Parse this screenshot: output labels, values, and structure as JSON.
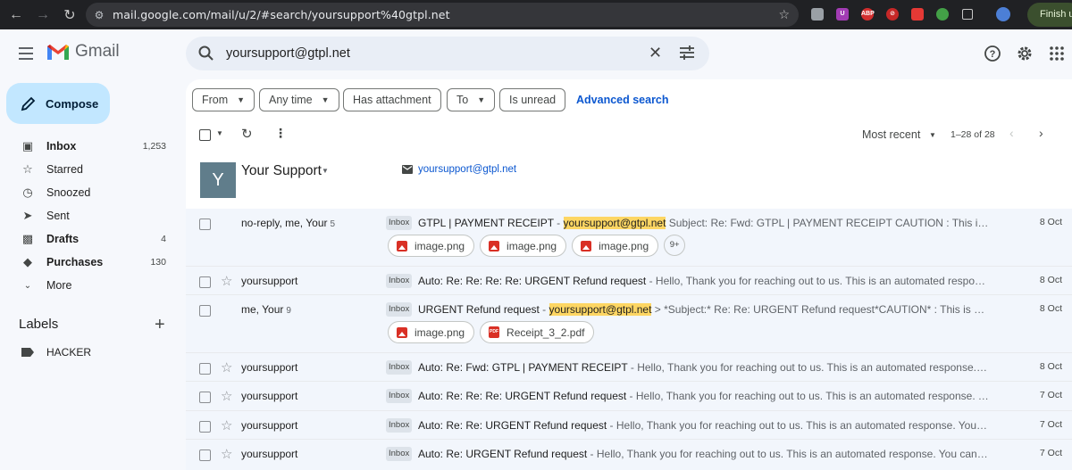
{
  "browser": {
    "url": "mail.google.com/mail/u/2/#search/yoursupport%40gtpl.net",
    "finish_label": "Finish up"
  },
  "app": {
    "name": "Gmail"
  },
  "search": {
    "query": "yoursupport@gtpl.net"
  },
  "compose_label": "Compose",
  "sidebar": {
    "items": [
      {
        "label": "Inbox",
        "count": "1,253",
        "icon": "inbox-icon"
      },
      {
        "label": "Starred",
        "count": "",
        "icon": "star-icon"
      },
      {
        "label": "Snoozed",
        "count": "",
        "icon": "clock-icon"
      },
      {
        "label": "Sent",
        "count": "",
        "icon": "send-icon"
      },
      {
        "label": "Drafts",
        "count": "4",
        "icon": "draft-icon"
      },
      {
        "label": "Purchases",
        "count": "130",
        "icon": "tag-icon"
      },
      {
        "label": "More",
        "count": "",
        "icon": "chevron-down-icon"
      }
    ],
    "labels_heading": "Labels",
    "labels": [
      {
        "label": "HACKER"
      }
    ]
  },
  "filters": {
    "from": "From",
    "time": "Any time",
    "attachment": "Has attachment",
    "to": "To",
    "unread": "Is unread",
    "advanced": "Advanced search"
  },
  "toolbar": {
    "sort": "Most recent",
    "pager": "1–28 of 28"
  },
  "contact": {
    "initial": "Y",
    "name": "Your Support",
    "email": "yoursupport@gtpl.net"
  },
  "emails": [
    {
      "sender": "no-reply, me, Your",
      "thread_count": "5",
      "badge": "Inbox",
      "subject": "GTPL | PAYMENT RECEIPT",
      "sep": " - ",
      "highlight": "yoursupport@gtpl.net",
      "snippet": " Subject: Re: Fwd: GTPL | PAYMENT RECEIPT CAUTION : This is outside ...",
      "date": "8 Oct",
      "attachments": [
        "image.png",
        "image.png",
        "image.png"
      ],
      "more_attachments": "9+"
    },
    {
      "sender": "yoursupport",
      "badge": "Inbox",
      "subject": "Auto: Re: Re: Re: Re: URGENT Refund request",
      "sep": " - ",
      "snippet": "Hello, Thank you for reaching out to us. This is an automated response. Yo...",
      "date": "8 Oct"
    },
    {
      "sender": "me, Your",
      "thread_count": "9",
      "badge": "Inbox",
      "subject": "URGENT Refund request",
      "sep": " - ",
      "highlight": "yoursupport@gtpl.net",
      "snippet": " > *Subject:* Re: Re: URGENT Refund request*CAUTION* : This is out...",
      "date": "8 Oct",
      "attachments": [
        "image.png",
        "Receipt_3_2.pdf"
      ]
    },
    {
      "sender": "yoursupport",
      "badge": "Inbox",
      "subject": "Auto: Re: Fwd: GTPL | PAYMENT RECEIPT",
      "sep": " - ",
      "snippet": "Hello, Thank you for reaching out to us. This is an automated response. You ca...",
      "date": "8 Oct"
    },
    {
      "sender": "yoursupport",
      "badge": "Inbox",
      "subject": "Auto: Re: Re: Re: URGENT Refund request",
      "sep": " - ",
      "snippet": "Hello, Thank you for reaching out to us. This is an automated response. You c...",
      "date": "7 Oct"
    },
    {
      "sender": "yoursupport",
      "badge": "Inbox",
      "subject": "Auto: Re: Re: URGENT Refund request",
      "sep": " - ",
      "snippet": "Hello, Thank you for reaching out to us. This is an automated response. You can c...",
      "date": "7 Oct"
    },
    {
      "sender": "yoursupport",
      "badge": "Inbox",
      "subject": "Auto: Re: URGENT Refund request",
      "sep": " - ",
      "snippet": "Hello, Thank you for reaching out to us. This is an automated response. You can chat ...",
      "date": "7 Oct"
    }
  ]
}
